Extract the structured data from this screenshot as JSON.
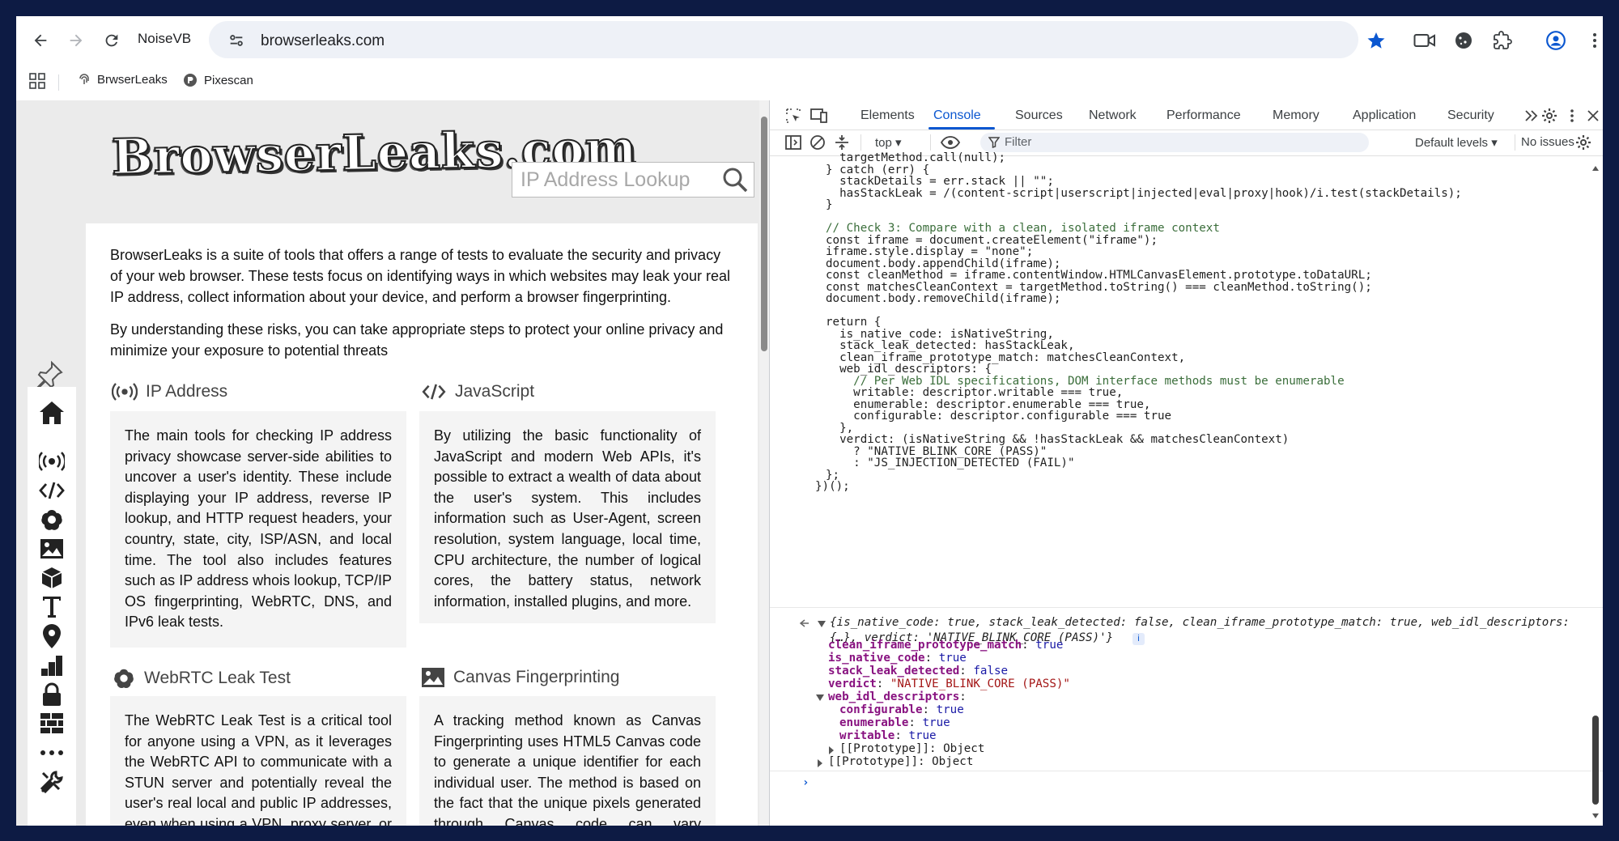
{
  "browser": {
    "profile": "NoiseVB",
    "url": "browserleaks.com",
    "bookmarks": [
      {
        "label": "BrwserLeaks"
      },
      {
        "label": "Pixescan"
      }
    ]
  },
  "page": {
    "logo_text": "BrowserLeaks.com",
    "search_placeholder": "IP Address Lookup",
    "intro": [
      "BrowserLeaks is a suite of tools that offers a range of tests to evaluate the security and privacy of your web browser. These tests focus on identifying ways in which websites may leak your real IP address, collect information about your device, and perform a browser fingerprinting.",
      "By understanding these risks, you can take appropriate steps to protect your online privacy and minimize your exposure to potential threats"
    ],
    "sections": [
      {
        "title": "IP Address",
        "text": "The main tools for checking IP address privacy showcase server-side abilities to uncover a user's identity. These include displaying your IP address, reverse IP lookup, and HTTP request headers, your country, state, city, ISP/ASN, and local time. The tool also includes features such as IP address whois lookup, TCP/IP OS fingerprinting, WebRTC, DNS, and IPv6 leak tests."
      },
      {
        "title": "JavaScript",
        "text": "By utilizing the basic functionality of JavaScript and modern Web APIs, it's possible to extract a wealth of data about the user's system. This includes information such as User-Agent, screen resolution, system language, local time, CPU architecture, the number of logical cores, the battery status, network information, installed plugins, and more."
      },
      {
        "title": "WebRTC Leak Test",
        "text": "The WebRTC Leak Test is a critical tool for anyone using a VPN, as it leverages the WebRTC API to communicate with a STUN server and potentially reveal the user's real local and public IP addresses, even when using a VPN, proxy server, or behind a NAT. This test can help you if"
      },
      {
        "title": "Canvas Fingerprinting",
        "text": "A tracking method known as Canvas Fingerprinting uses HTML5 Canvas code to generate a unique identifier for each individual user. The method is based on the fact that the unique pixels generated through Canvas code can vary depending on the system and browser"
      }
    ]
  },
  "devtools": {
    "tabs": [
      "Elements",
      "Console",
      "Sources",
      "Network",
      "Performance",
      "Memory",
      "Application",
      "Security"
    ],
    "active_tab": "Console",
    "context": "top",
    "filter_placeholder": "Filter",
    "levels": "Default levels",
    "issues": "No issues",
    "code_lines": [
      "  targetMethod.call(null);",
      "} catch (err) {",
      "  stackDetails = err.stack || \"\";",
      "  hasStackLeak = /(content-script|userscript|injected|eval|proxy|hook)/i.test(stackDetails);",
      "}",
      "",
      "// Check 3: Compare with a clean, isolated iframe context",
      "const iframe = document.createElement(\"iframe\");",
      "iframe.style.display = \"none\";",
      "document.body.appendChild(iframe);",
      "const cleanMethod = iframe.contentWindow.HTMLCanvasElement.prototype.toDataURL;",
      "const matchesCleanContext = targetMethod.toString() === cleanMethod.toString();",
      "document.body.removeChild(iframe);",
      "",
      "return {",
      "  is_native_code: isNativeString,",
      "  stack_leak_detected: hasStackLeak,",
      "  clean_iframe_prototype_match: matchesCleanContext,",
      "  web_idl_descriptors: {",
      "    // Per Web IDL specifications, DOM interface methods must be enumerable",
      "    writable: descriptor.writable === true,",
      "    enumerable: descriptor.enumerable === true,",
      "    configurable: descriptor.configurable === true",
      "  },",
      "  verdict: (isNativeString && !hasStackLeak && matchesCleanContext)",
      "    ? \"NATIVE_BLINK_CORE (PASS)\"",
      "    : \"JS_INJECTION_DETECTED (FAIL)\"",
      "};",
      "})();"
    ],
    "result_summary_1": "{is_native_code: true, stack_leak_detected: false, clean_iframe_prototype_match: true, web_idl_descriptors:",
    "result_summary_2": "{…}, verdict: 'NATIVE_BLINK_CORE (PASS)'}",
    "result_props": [
      {
        "key": "clean_iframe_prototype_match",
        "value": "true"
      },
      {
        "key": "is_native_code",
        "value": "true"
      },
      {
        "key": "stack_leak_detected",
        "value": "false"
      },
      {
        "key": "verdict",
        "value": "\"NATIVE_BLINK_CORE (PASS)\""
      }
    ],
    "web_idl_key": "web_idl_descriptors",
    "web_idl_props": [
      {
        "key": "configurable",
        "value": "true"
      },
      {
        "key": "enumerable",
        "value": "true"
      },
      {
        "key": "writable",
        "value": "true"
      }
    ],
    "proto_inner": "[[Prototype]]: Object",
    "proto_outer": "[[Prototype]]: Object",
    "prompt": "›"
  }
}
